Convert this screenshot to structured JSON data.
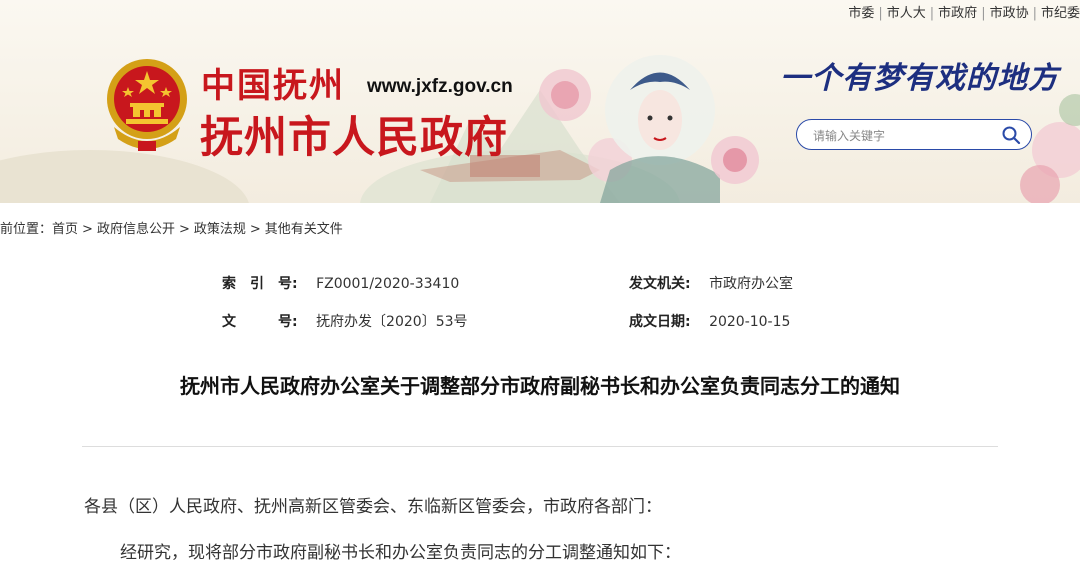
{
  "header": {
    "top_links": [
      "市委",
      "市人大",
      "市政府",
      "市政协",
      "市纪委"
    ],
    "site_name_cn": "中国抚州",
    "site_url": "www.jxfz.gov.cn",
    "main_title": "抚州市人民政府",
    "slogan": "一个有梦有戏的地方",
    "search": {
      "placeholder": "请输入关键字"
    },
    "colors": {
      "brand_red": "#c8171d",
      "slogan_blue": "#1d2f80",
      "search_border": "#2a4aa8"
    }
  },
  "breadcrumb": {
    "prefix": "前位置：",
    "items": [
      "首页",
      "政府信息公开",
      "政策法规",
      "其他有关文件"
    ],
    "separator": ">"
  },
  "doc_meta": {
    "index_label": "索　引　号:",
    "index_value": "FZ0001/2020-33410",
    "issuer_label": "发文机关:",
    "issuer_value": "市政府办公室",
    "docno_label": "文　　　号:",
    "docno_value": "抚府办发〔2020〕53号",
    "date_label": "成文日期:",
    "date_value": "2020-10-15"
  },
  "article": {
    "title": "抚州市人民政府办公室关于调整部分市政府副秘书长和办公室负责同志分工的通知",
    "salutation": "各县（区）人民政府、抚州高新区管委会、东临新区管委会，市政府各部门：",
    "paragraph1": "经研究，现将部分市政府副秘书长和办公室负责同志的分工调整通知如下："
  }
}
